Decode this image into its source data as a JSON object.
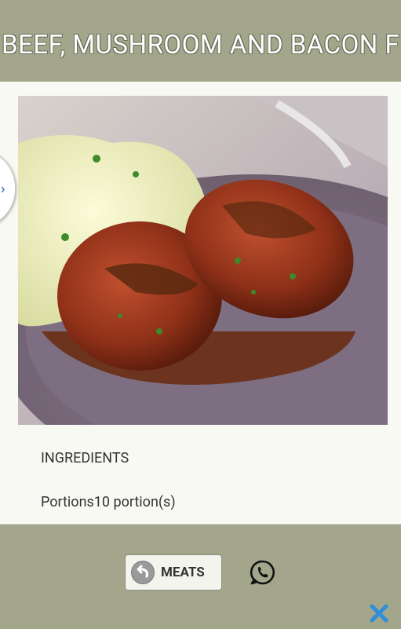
{
  "header": {
    "title": "BEEF, MUSHROOM AND BACON F"
  },
  "recipe": {
    "ingredients_heading": "INGREDIENTS",
    "portions_text": "Portions10 portion(s)"
  },
  "footer": {
    "back_button_label": "MEATS",
    "share_icon": "whatsapp-icon",
    "close_icon": "close-icon"
  },
  "colors": {
    "header_bg": "#a3a68a",
    "content_bg": "#f9f9f3",
    "close_blue": "#2f8ed8"
  }
}
